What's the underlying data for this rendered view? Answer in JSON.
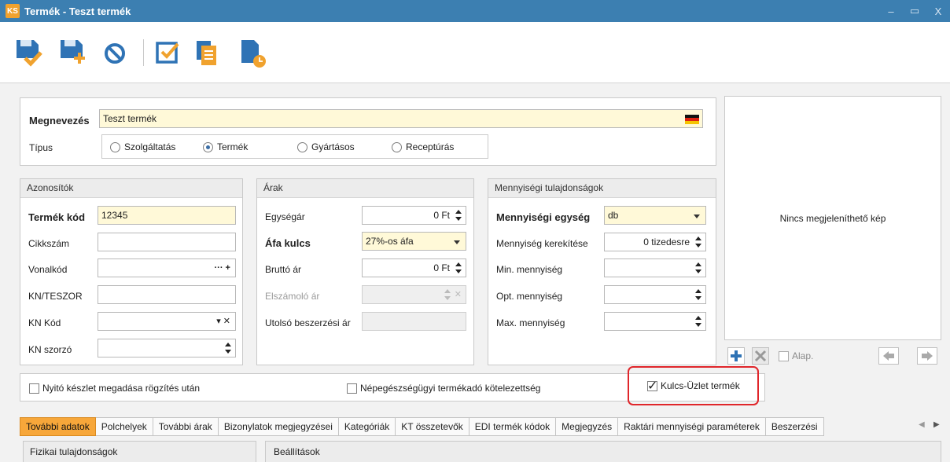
{
  "window": {
    "logo": "KS",
    "title": "Termék - Teszt termék",
    "controls": [
      "–",
      "▭",
      "X"
    ]
  },
  "toolbar": {
    "icons": [
      "save-check-icon",
      "save-new-icon",
      "cancel-icon",
      "checklist-icon",
      "copy-document-icon",
      "document-clock-icon"
    ],
    "accent": "#3c7fb1"
  },
  "general": {
    "name_label": "Megnevezés",
    "name_value": "Teszt termék",
    "type_label": "Típus",
    "types": [
      {
        "label": "Szolgáltatás",
        "selected": false
      },
      {
        "label": "Termék",
        "selected": true
      },
      {
        "label": "Gyártásos",
        "selected": false
      },
      {
        "label": "Receptúrás",
        "selected": false
      }
    ]
  },
  "identifiers": {
    "title": "Azonosítók",
    "code_label": "Termék kód",
    "code_value": "12345",
    "item_no_label": "Cikkszám",
    "item_no_value": "",
    "barcode_label": "Vonalkód",
    "barcode_value": "",
    "kn_teszor_label": "KN/TESZOR",
    "kn_teszor_value": "",
    "kn_code_label": "KN Kód",
    "kn_code_value": "",
    "kn_multiplier_label": "KN szorzó",
    "kn_multiplier_value": ""
  },
  "prices": {
    "title": "Árak",
    "unit_price_label": "Egységár",
    "unit_price_value": "0 Ft",
    "vat_label": "Áfa kulcs",
    "vat_value": "27%-os áfa",
    "gross_label": "Bruttó ár",
    "gross_value": "0 Ft",
    "settlement_label": "Elszámoló ár",
    "settlement_value": "",
    "last_purchase_label": "Utolsó beszerzési ár",
    "last_purchase_value": ""
  },
  "quantity": {
    "title": "Mennyiségi tulajdonságok",
    "unit_label": "Mennyiségi egység",
    "unit_value": "db",
    "rounding_label": "Mennyiség kerekítése",
    "rounding_value": "0 tizedesre",
    "min_label": "Min. mennyiség",
    "min_value": "",
    "opt_label": "Opt. mennyiség",
    "opt_value": "",
    "max_label": "Max. mennyiség",
    "max_value": ""
  },
  "image_panel": {
    "empty_text": "Nincs megjeleníthető kép",
    "default_label": "Alap."
  },
  "options": {
    "opening_stock": "Nyitó készlet megadása rögzítés után",
    "health_tax": "Népegészségügyi termékadó kötelezettség",
    "kulcs_store": "Kulcs-Üzlet termék",
    "kulcs_store_checked": true,
    "highlight_color": "#e0262b"
  },
  "tabs": [
    "További adatok",
    "Polchelyek",
    "További árak",
    "Bizonylatok megjegyzései",
    "Kategóriák",
    "KT összetevők",
    "EDI termék kódok",
    "Megjegyzés",
    "Raktári mennyiségi paraméterek",
    "Beszerzési"
  ],
  "bottom_groups": {
    "physical": "Fizikai tulajdonságok",
    "settings": "Beállítások"
  }
}
